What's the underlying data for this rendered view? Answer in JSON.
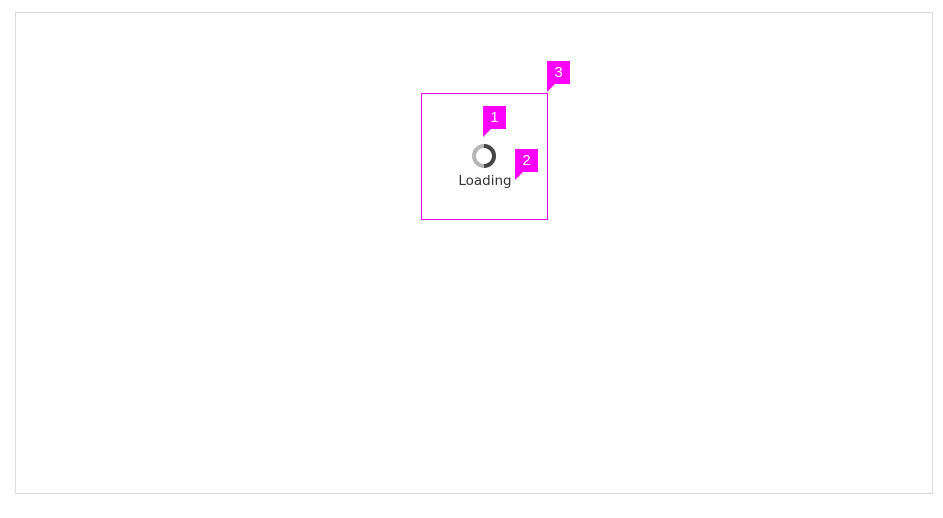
{
  "loader": {
    "label": "Loading"
  },
  "callouts": {
    "c1": "1",
    "c2": "2",
    "c3": "3"
  },
  "colors": {
    "callout": "#ff00ff",
    "callout_box": "#e000e0",
    "spinner_track": "#b5b5b5",
    "spinner_arc": "#444444",
    "frame_border": "#dcdcdc"
  },
  "icons": {
    "spinner": "spinner-icon"
  }
}
